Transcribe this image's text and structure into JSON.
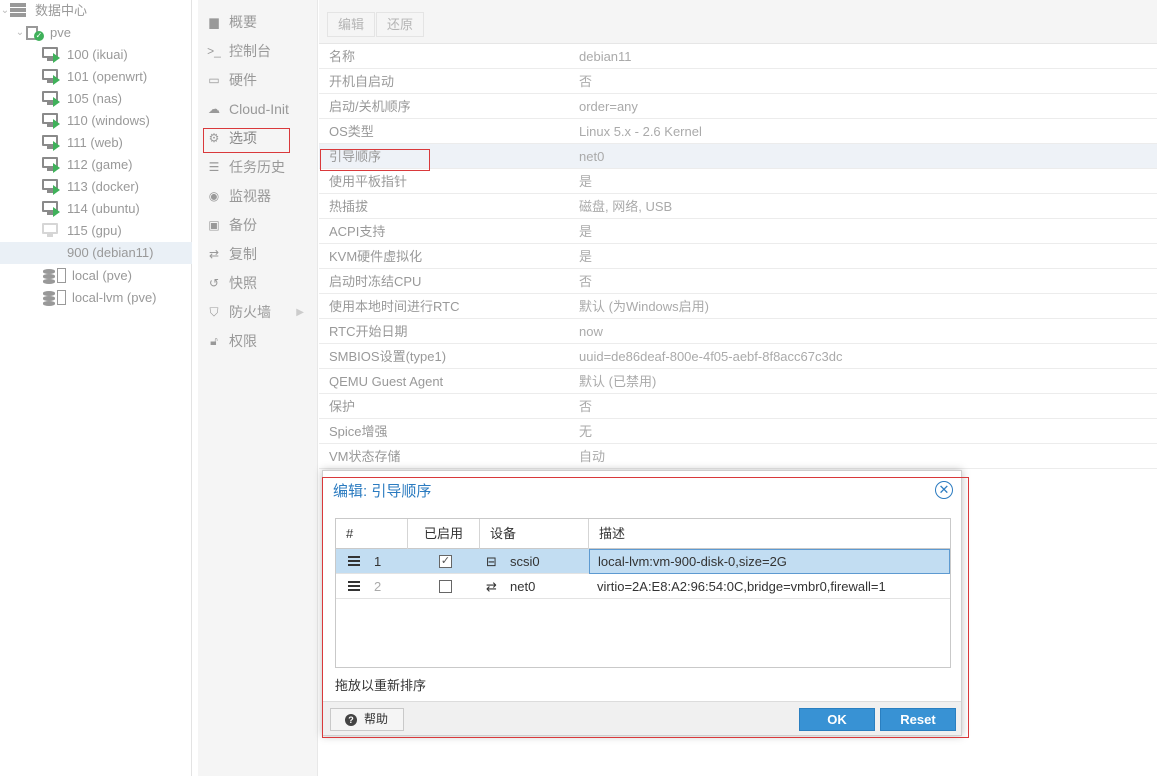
{
  "tree": {
    "datacenter": "数据中心",
    "node": "pve",
    "vms": [
      {
        "label": "100 (ikuai)",
        "running": true
      },
      {
        "label": "101 (openwrt)",
        "running": true
      },
      {
        "label": "105 (nas)",
        "running": true
      },
      {
        "label": "110 (windows)",
        "running": true
      },
      {
        "label": "111 (web)",
        "running": true
      },
      {
        "label": "112 (game)",
        "running": true
      },
      {
        "label": "113 (docker)",
        "running": true
      },
      {
        "label": "114 (ubuntu)",
        "running": true
      },
      {
        "label": "115 (gpu)",
        "running": false
      }
    ],
    "template": "900 (debian11)",
    "storages": [
      "local (pve)",
      "local-lvm (pve)"
    ]
  },
  "nav": {
    "items": [
      {
        "label": "概要",
        "icon": "book-icon"
      },
      {
        "label": "控制台",
        "icon": "terminal-icon"
      },
      {
        "label": "硬件",
        "icon": "monitor-icon"
      },
      {
        "label": "Cloud-Init",
        "icon": "cloud-icon"
      },
      {
        "label": "选项",
        "icon": "gear-icon"
      },
      {
        "label": "任务历史",
        "icon": "list-icon"
      },
      {
        "label": "监视器",
        "icon": "eye-icon"
      },
      {
        "label": "备份",
        "icon": "floppy-icon"
      },
      {
        "label": "复制",
        "icon": "retweet-icon"
      },
      {
        "label": "快照",
        "icon": "history-icon"
      },
      {
        "label": "防火墙",
        "icon": "shield-icon"
      },
      {
        "label": "权限",
        "icon": "unlock-icon"
      }
    ]
  },
  "toolbar": {
    "edit": "编辑",
    "revert": "还原"
  },
  "options": [
    {
      "key": "名称",
      "value": "debian11"
    },
    {
      "key": "开机自启动",
      "value": "否"
    },
    {
      "key": "启动/关机顺序",
      "value": "order=any"
    },
    {
      "key": "OS类型",
      "value": "Linux 5.x - 2.6 Kernel"
    },
    {
      "key": "引导顺序",
      "value": "net0"
    },
    {
      "key": "使用平板指针",
      "value": "是"
    },
    {
      "key": "热插拔",
      "value": "磁盘, 网络, USB"
    },
    {
      "key": "ACPI支持",
      "value": "是"
    },
    {
      "key": "KVM硬件虚拟化",
      "value": "是"
    },
    {
      "key": "启动时冻结CPU",
      "value": "否"
    },
    {
      "key": "使用本地时间进行RTC",
      "value": "默认 (为Windows启用)"
    },
    {
      "key": "RTC开始日期",
      "value": "now"
    },
    {
      "key": "SMBIOS设置(type1)",
      "value": "uuid=de86deaf-800e-4f05-aebf-8f8acc67c3dc"
    },
    {
      "key": "QEMU Guest Agent",
      "value": "默认 (已禁用)"
    },
    {
      "key": "保护",
      "value": "否"
    },
    {
      "key": "Spice增强",
      "value": "无"
    },
    {
      "key": "VM状态存储",
      "value": "自动"
    }
  ],
  "dialog": {
    "title": "编辑: 引导顺序",
    "columns": {
      "num": "#",
      "enabled": "已启用",
      "device": "设备",
      "desc": "描述"
    },
    "rows": [
      {
        "num": "1",
        "enabled": true,
        "device": "scsi0",
        "desc": "local-lvm:vm-900-disk-0,size=2G"
      },
      {
        "num": "2",
        "enabled": false,
        "device": "net0",
        "desc": "virtio=2A:E8:A2:96:54:0C,bridge=vmbr0,firewall=1"
      }
    ],
    "hint": "拖放以重新排序",
    "help": "帮助",
    "ok": "OK",
    "reset": "Reset"
  }
}
